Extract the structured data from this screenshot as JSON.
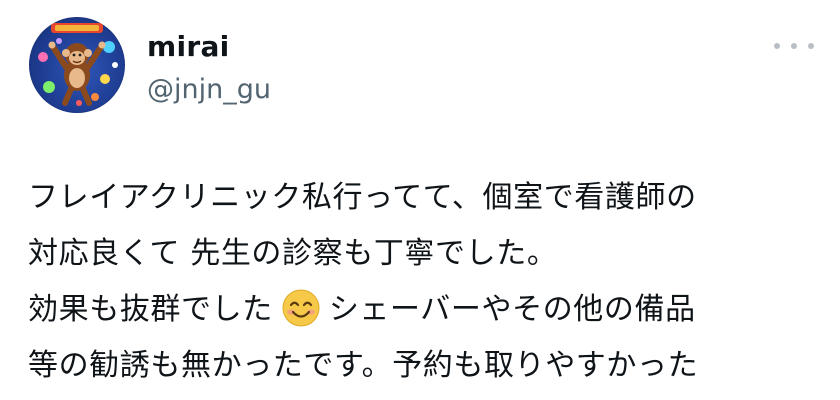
{
  "user": {
    "display_name": "mirai",
    "handle": "@jnjn_gu",
    "avatar_icon": "monkey-character-avatar"
  },
  "more_icon": "ellipsis-horizontal-icon",
  "tweet": {
    "lines": [
      "フレイアクリニック私行ってて、個室で看護師の",
      "対応良くて 先生の診察も丁寧でした。",
      "効果も抜群でした",
      "等の勧誘も無かったです。予約も取りやすかった"
    ],
    "line3_after_emoji": "シェーバーやその他の備品",
    "emoji_icon": "smiling-face-icon"
  },
  "colors": {
    "text": "#0f1419",
    "secondary": "#536471",
    "emoji_face": "#f7c948"
  }
}
